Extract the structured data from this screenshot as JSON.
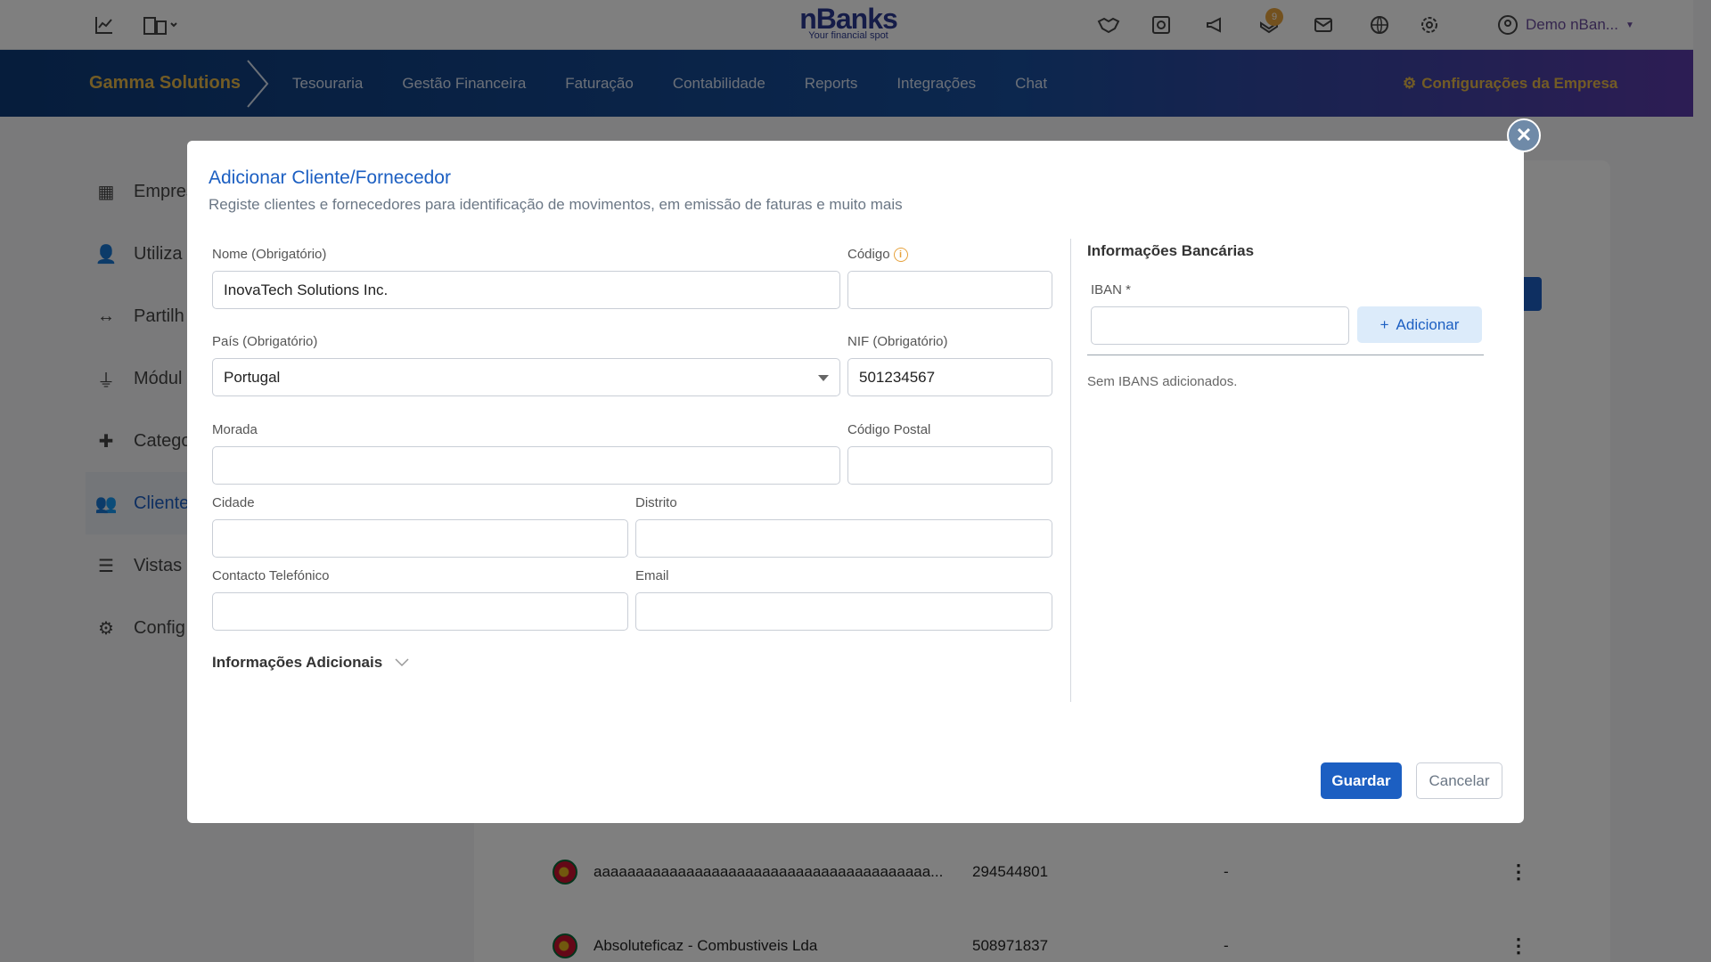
{
  "topbar": {
    "logo_brand": "nBanks",
    "logo_tagline": "Your financial spot",
    "notifications_count": "9",
    "user_name": "Demo nBan..."
  },
  "navbar": {
    "company": "Gamma Solutions",
    "items": [
      "Tesouraria",
      "Gestão Financeira",
      "Faturação",
      "Contabilidade",
      "Reports",
      "Integrações",
      "Chat"
    ],
    "settings": "Configurações da Empresa"
  },
  "sidemenu": {
    "items": [
      "Empres",
      "Utiliza",
      "Partilh",
      "Módul",
      "Catego",
      "Cliente",
      "Vistas F",
      "Config"
    ],
    "active_index": 5
  },
  "bg_table": {
    "rows": [
      {
        "name": "aaaaaaaaaaaaaaaaaaaaaaaaaaaaaaaaaaaaaaaa...",
        "nif": "294544801",
        "extra": "-"
      },
      {
        "name": "Absoluteficaz - Combustiveis Lda",
        "nif": "508971837",
        "extra": "-"
      }
    ]
  },
  "modal": {
    "title": "Adicionar Cliente/Fornecedor",
    "subtitle": "Registe clientes e fornecedores para identificação de movimentos, em emissão de faturas e muito mais",
    "fields": {
      "nome": {
        "label": "Nome (Obrigatório)",
        "value": "InovaTech Solutions Inc."
      },
      "codigo": {
        "label": "Código",
        "value": ""
      },
      "pais": {
        "label": "País (Obrigatório)",
        "value": "Portugal"
      },
      "nif": {
        "label": "NIF (Obrigatório)",
        "value": "501234567"
      },
      "morada": {
        "label": "Morada",
        "value": ""
      },
      "codigo_postal": {
        "label": "Código Postal",
        "value": ""
      },
      "cidade": {
        "label": "Cidade",
        "value": ""
      },
      "distrito": {
        "label": "Distrito",
        "value": ""
      },
      "telefone": {
        "label": "Contacto Telefónico",
        "value": ""
      },
      "email": {
        "label": "Email",
        "value": ""
      }
    },
    "additional_info": "Informações Adicionais",
    "bank": {
      "title": "Informações Bancárias",
      "iban_label": "IBAN *",
      "iban_value": "",
      "add_button": "Adicionar",
      "empty_text": "Sem IBANS adicionados."
    },
    "save_button": "Guardar",
    "cancel_button": "Cancelar"
  },
  "colors": {
    "primary": "#1c5fc2",
    "accent_gold": "#e7b84a",
    "brand": "#2b3990"
  }
}
